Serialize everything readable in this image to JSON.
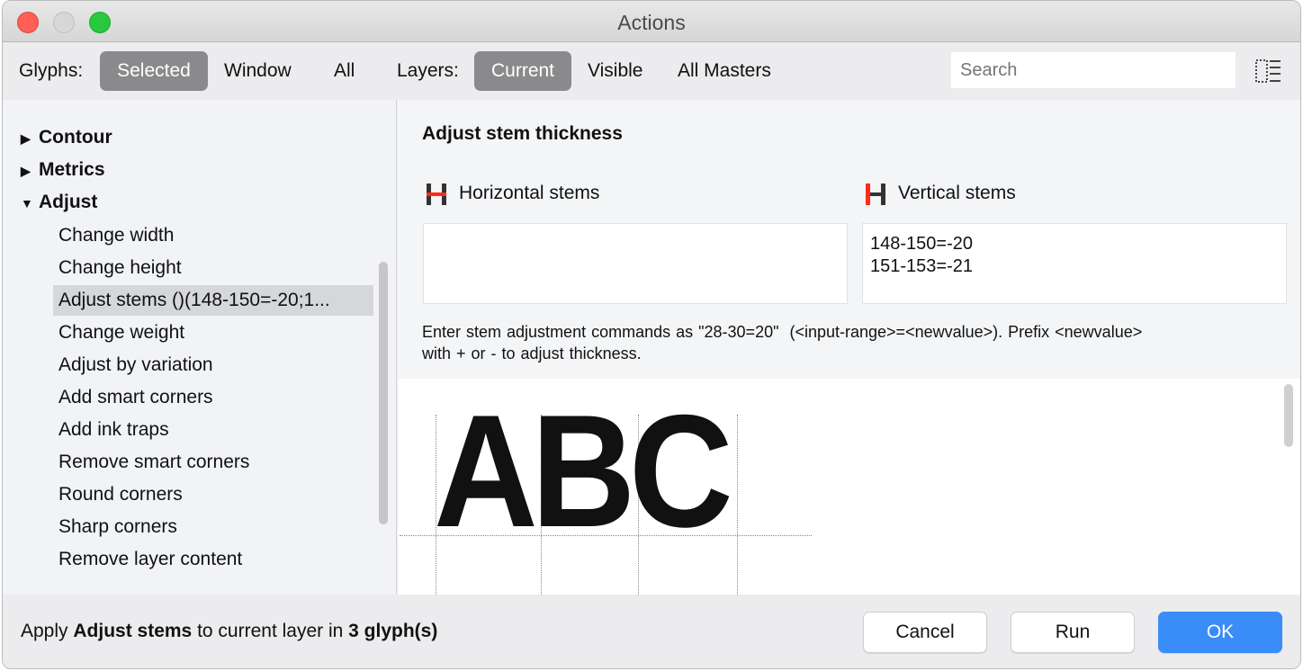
{
  "window": {
    "title": "Actions"
  },
  "toolbar": {
    "glyphs_label": "Glyphs:",
    "glyphs_options": [
      "Selected",
      "Window",
      "All"
    ],
    "glyphs_selected": "Selected",
    "layers_label": "Layers:",
    "layers_options": [
      "Current",
      "Visible",
      "All Masters"
    ],
    "layers_selected": "Current",
    "search_placeholder": "Search"
  },
  "sidebar": {
    "groups": [
      {
        "label": "Contour",
        "expanded": false
      },
      {
        "label": "Metrics",
        "expanded": false
      },
      {
        "label": "Adjust",
        "expanded": true
      }
    ],
    "items": [
      "Change width",
      "Change height",
      "Adjust stems ()(148-150=-20;1...",
      "Change weight",
      "Adjust by variation",
      "Add smart corners",
      "Add ink traps",
      "Remove smart corners",
      "Round corners",
      "Sharp corners",
      "Remove layer content"
    ],
    "selected_index": 2
  },
  "panel": {
    "heading": "Adjust stem thickness",
    "horizontal_label": "Horizontal stems",
    "horizontal_value": "",
    "vertical_label": "Vertical stems",
    "vertical_lines": [
      "148-150=-20",
      "151-153=-21"
    ],
    "help_line1": "Enter stem adjustment commands as \"28-30=20\"  (<input-range>=<newvalue>). Prefix <newvalue>",
    "help_line2": "with + or - to adjust thickness."
  },
  "preview": {
    "text": "ABC"
  },
  "footer": {
    "status_prefix": "Apply ",
    "status_action": "Adjust stems",
    "status_middle": " to current layer in ",
    "status_count": "3 glyph(s)",
    "cancel": "Cancel",
    "run": "Run",
    "ok": "OK"
  },
  "colors": {
    "accent": "#3a8cf8",
    "close": "#fe5f57",
    "minimize": "#d0d0d0",
    "zoom": "#28c840",
    "stem_red": "#ff2a1a"
  }
}
